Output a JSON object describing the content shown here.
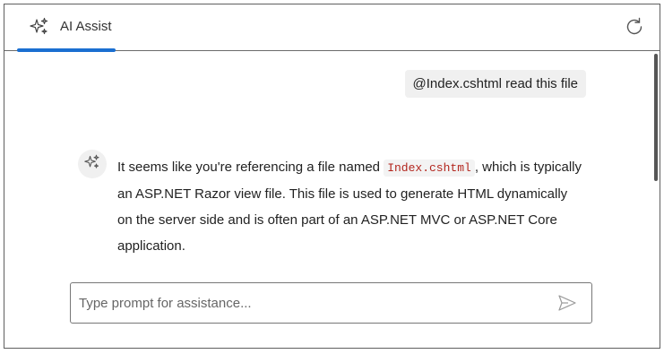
{
  "header": {
    "tab_label": "AI Assist",
    "tab_icon": "sparkle-icon",
    "refresh_icon": "refresh-icon",
    "accent_color": "#1a6fd1"
  },
  "conversation": {
    "user_message": "@Index.cshtml read this file",
    "ai_avatar_icon": "sparkle-icon",
    "ai_message": {
      "text_before": "It seems like you're referencing a file named ",
      "code": "Index.cshtml",
      "text_after": ", which is typically an ASP.NET Razor view file. This file is used to generate HTML dynamically on the server side and is often part of an ASP.NET MVC or ASP.NET Core application."
    }
  },
  "prompt": {
    "placeholder": "Type prompt for assistance...",
    "value": "",
    "send_icon": "send-icon"
  }
}
